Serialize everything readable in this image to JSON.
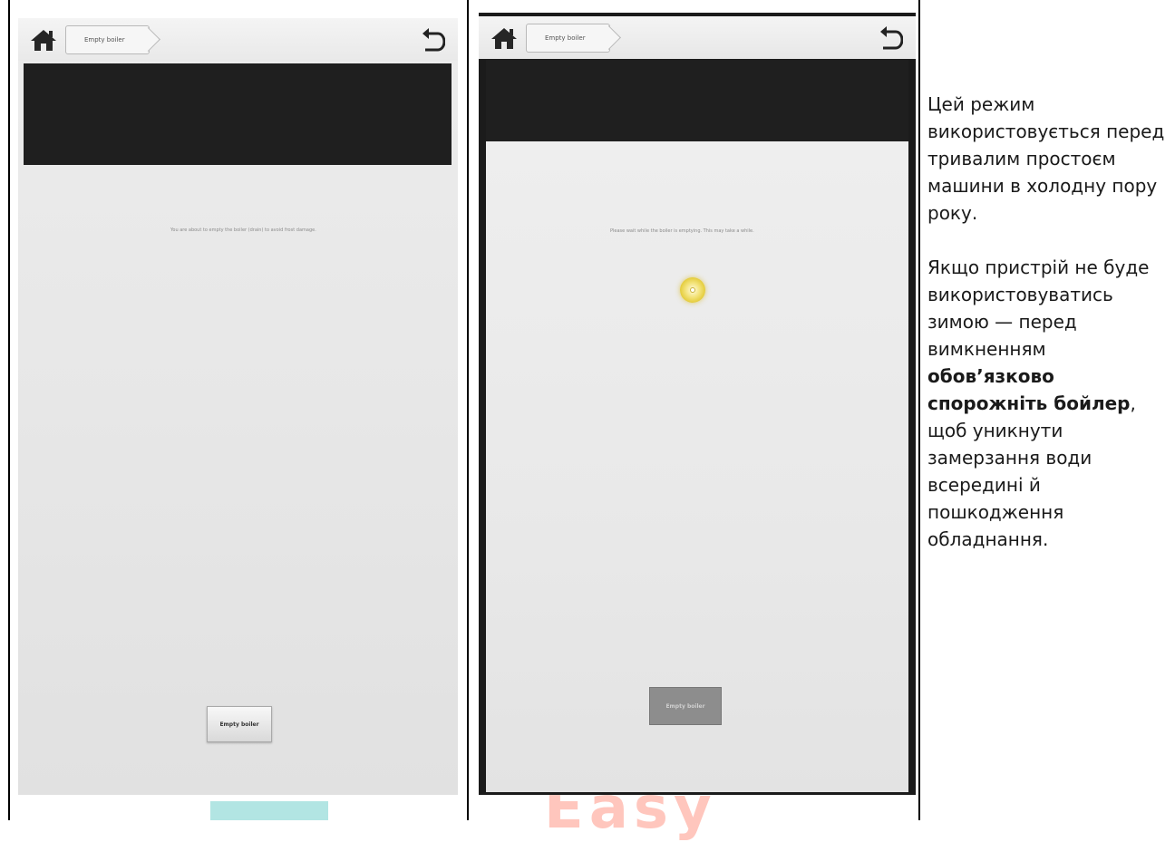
{
  "panels": [
    {
      "breadcrumb": "Empty boiler",
      "message": "You are about to empty the boiler (drain) to avoid frost damage.",
      "button_label": "Empty boiler"
    },
    {
      "breadcrumb": "Empty boiler",
      "message": "Please wait while the boiler is emptying. This may take a while.",
      "button_label": "Empty boiler"
    }
  ],
  "description": {
    "p1": "Цей режим використовується перед тривалим простоєм машини в холодну пору року.",
    "p2_before": "Якщо пристрій не буде використовуватись зимою — перед вимкненням ",
    "p2_bold": "обов’язково спорожніть бойлер",
    "p2_after": ", щоб уникнути замерзання води всередині й пошкодження обладнання."
  },
  "watermark": {
    "text": "Easy"
  },
  "colors": {
    "watermark_teal": "#21b5b0",
    "watermark_red": "#ffb3a8",
    "spinner": "#e4cc3c"
  },
  "icons": [
    "home-icon",
    "back-arrow-icon",
    "loading-spinner-icon"
  ]
}
